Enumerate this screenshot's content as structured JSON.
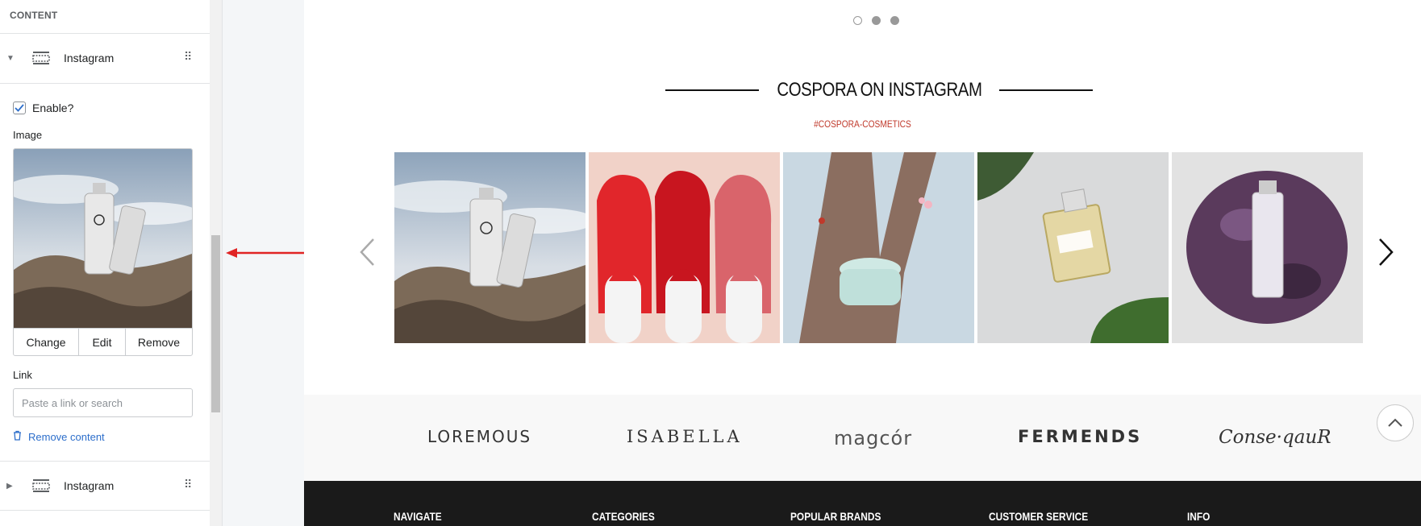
{
  "editor": {
    "section_heading": "CONTENT",
    "blocks": [
      {
        "label": "Instagram",
        "expanded": true
      },
      {
        "label": "Instagram",
        "expanded": false
      }
    ],
    "enable_label": "Enable?",
    "enable_checked": true,
    "image_label": "Image",
    "image_buttons": [
      "Change",
      "Edit",
      "Remove"
    ],
    "link_label": "Link",
    "link_placeholder": "Paste a link or search",
    "link_value": "",
    "remove_content_label": "Remove content"
  },
  "preview": {
    "slider_dots": 3,
    "active_dot": 0,
    "instagram_title": "COSPORA ON INSTAGRAM",
    "instagram_tag": "#COSPORA-COSMETICS",
    "gallery": [
      "skincare-bottles-on-rocks",
      "red-lipstick-swatches",
      "cream-jar-in-tree",
      "chanel-perfume-bottle",
      "serum-bottle-on-amethyst"
    ],
    "brands": [
      "LOREMOUS",
      "ISABELLA",
      "magcór",
      "FERMENDS",
      "Conse·qauR"
    ],
    "footer_columns": [
      "NAVIGATE",
      "CATEGORIES",
      "POPULAR BRANDS",
      "CUSTOMER SERVICE",
      "INFO"
    ]
  },
  "colors": {
    "accent_red": "#c0392b",
    "link_blue": "#2c6ecb",
    "footer_bg": "#1a1a1a",
    "annotation_arrow": "#e02424"
  }
}
